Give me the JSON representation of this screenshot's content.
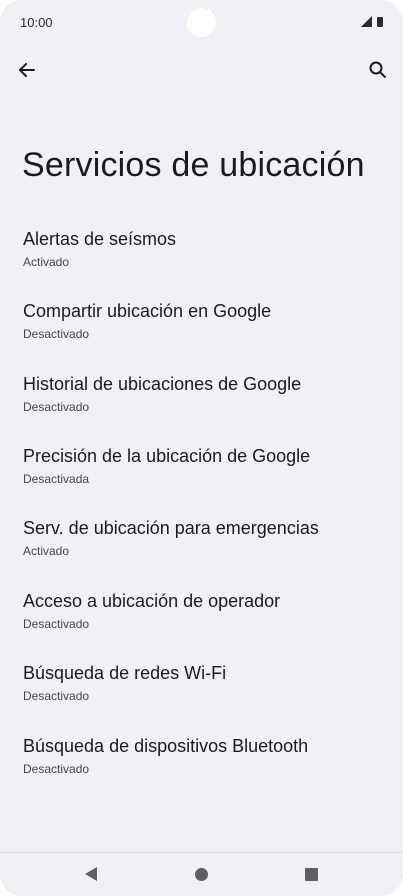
{
  "status_bar": {
    "time": "10:00",
    "icons": [
      "signal-icon",
      "battery-icon"
    ]
  },
  "top_bar": {
    "back_icon": "arrow-back-icon",
    "search_icon": "search-icon"
  },
  "page": {
    "title": "Servicios de ubicación"
  },
  "settings": {
    "items": [
      {
        "title": "Alertas de seísmos",
        "subtitle": "Activado"
      },
      {
        "title": "Compartir ubicación en Google",
        "subtitle": "Desactivado"
      },
      {
        "title": "Historial de ubicaciones de Google",
        "subtitle": "Desactivado"
      },
      {
        "title": "Precisión de la ubicación de Google",
        "subtitle": "Desactivada"
      },
      {
        "title": "Serv. de ubicación para emergencias",
        "subtitle": "Activado"
      },
      {
        "title": "Acceso a ubicación de operador",
        "subtitle": "Desactivado"
      },
      {
        "title": "Búsqueda de redes Wi-Fi",
        "subtitle": "Desactivado"
      },
      {
        "title": "Búsqueda de dispositivos Bluetooth",
        "subtitle": "Desactivado"
      }
    ]
  },
  "nav_bar": {
    "buttons": [
      "back-triangle-icon",
      "home-circle-icon",
      "recents-square-icon"
    ]
  },
  "colors": {
    "background": "#f1f0f5",
    "text_primary": "#1b1b1f",
    "text_secondary": "#45464f",
    "nav_icon": "#5f5f63"
  }
}
